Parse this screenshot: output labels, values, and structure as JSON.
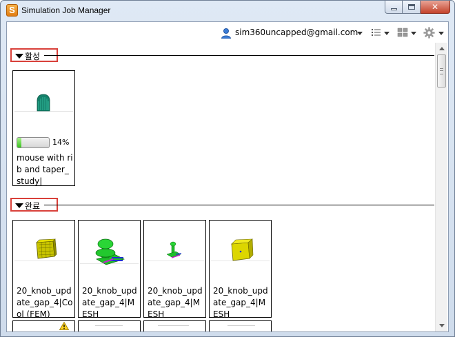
{
  "window": {
    "title": "Simulation Job Manager",
    "app_icon_letter": "S",
    "close_glyph": "✕"
  },
  "toolbar": {
    "user_email": "sim360uncapped@gmail.com"
  },
  "sections": {
    "active": {
      "label": "활성",
      "jobs": [
        {
          "name": "mouse with rib and taper_study|",
          "progress": 14,
          "progress_text": "14%"
        }
      ]
    },
    "completed": {
      "label": "완료",
      "jobs": [
        {
          "name": "20_knob_update_gap_4|Cool (FEM)",
          "thumb": "yellow-block"
        },
        {
          "name": "20_knob_update_gap_4|MESH",
          "thumb": "green-knob"
        },
        {
          "name": "20_knob_update_gap_4|MESH",
          "thumb": "small-green-knob"
        },
        {
          "name": "20_knob_update_gap_4|MESH",
          "thumb": "yellow-cube"
        }
      ]
    }
  },
  "colors": {
    "section_highlight": "#d9403a",
    "progress_green": "#3cc421",
    "part_yellow": "#e6e000",
    "part_green": "#1fbf2a",
    "part_teal": "#14806a"
  }
}
